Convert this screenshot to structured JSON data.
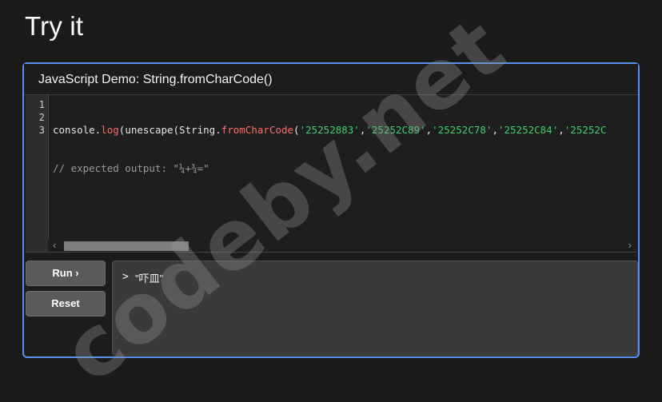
{
  "page": {
    "title": "Try it"
  },
  "demo": {
    "title": "JavaScript Demo: String.fromCharCode()",
    "line_numbers": [
      "1",
      "2",
      "3"
    ],
    "code": {
      "line1": {
        "t0": "console.",
        "t1": "log",
        "t2": "(unescape(String.",
        "t3": "fromCharCode",
        "t4": "(",
        "t5": "'25252883'",
        "t6": ",",
        "t7": "'25252C89'",
        "t8": ",",
        "t9": "'25252C78'",
        "t10": ",",
        "t11": "'25252C84'",
        "t12": ",",
        "t13": "'25252C"
      },
      "line2": "// expected output: \"¼+¾=\"",
      "line3": ""
    },
    "scrollbar": {
      "left_arrow": "‹",
      "right_arrow": "›"
    }
  },
  "buttons": {
    "run": "Run ›",
    "reset": "Reset"
  },
  "console": {
    "prompt": ">",
    "output": "\"吓皿\""
  },
  "watermark": {
    "text": "codeby.net"
  },
  "colors": {
    "accent": "#5b8ff0",
    "string": "#3fcf6b",
    "function": "#ff6b6b",
    "comment": "#9a9a9a"
  }
}
